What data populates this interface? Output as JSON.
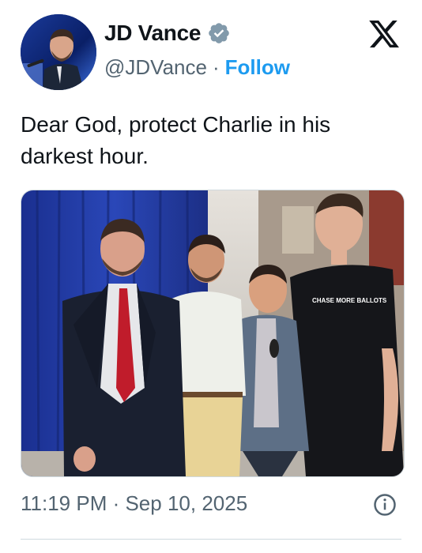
{
  "author": {
    "name": "JD Vance",
    "handle": "@JDVance",
    "separator": "·",
    "follow_label": "Follow",
    "verified_icon": "verified-badge-icon"
  },
  "platform_icon": "x-logo-icon",
  "tweet": {
    "text": "Dear God, protect Charlie in his darkest hour."
  },
  "photo_shirt_text": "CHASE MORE BALLOTS",
  "footer": {
    "timestamp": "11:19 PM · Sep 10, 2025",
    "info_icon": "info-icon"
  },
  "colors": {
    "accent": "#1d9bf0",
    "verified_badge": "#829aab",
    "text_primary": "#0f1419",
    "text_secondary": "#536471"
  }
}
